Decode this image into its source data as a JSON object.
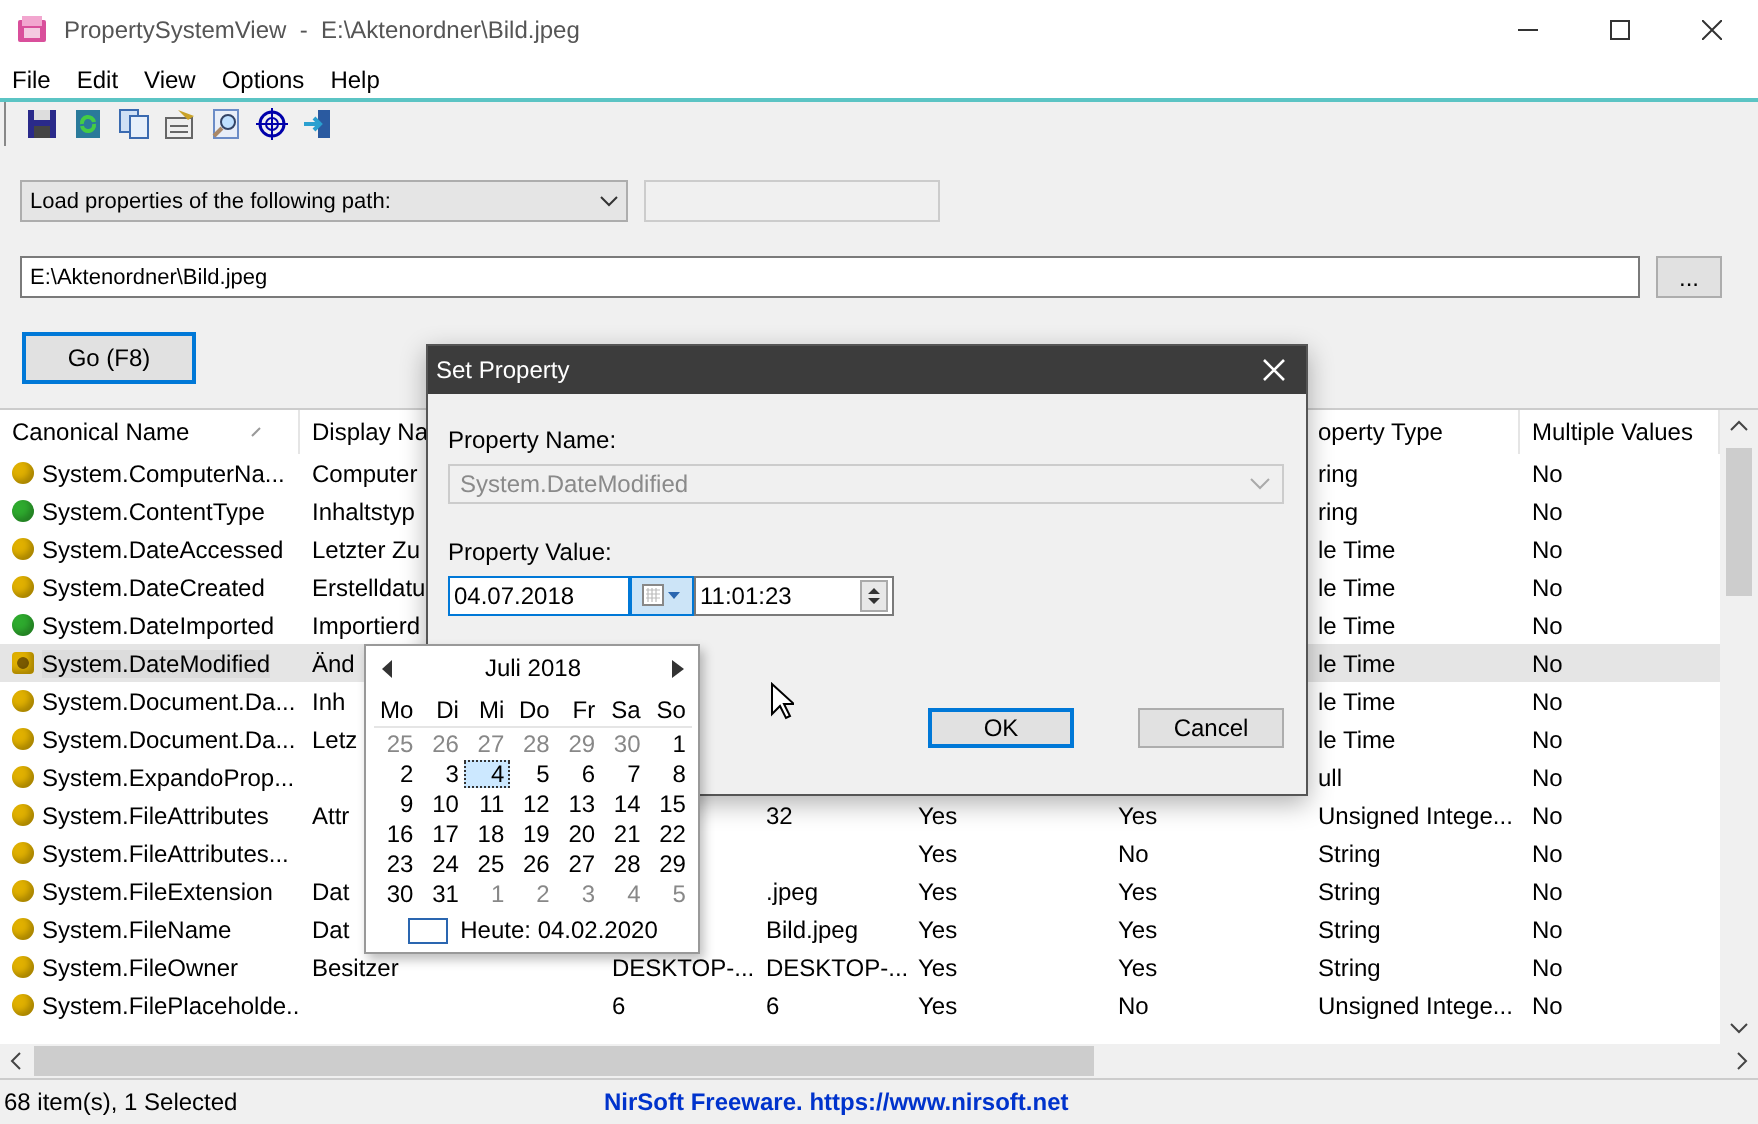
{
  "window": {
    "title": "PropertySystemView  -  E:\\Aktenordner\\Bild.jpeg"
  },
  "menu": [
    "File",
    "Edit",
    "View",
    "Options",
    "Help"
  ],
  "load_mode": {
    "value": "Load properties of the following path:"
  },
  "path_field": {
    "value": "E:\\Aktenordner\\Bild.jpeg"
  },
  "browse_button": "...",
  "go_button": {
    "label": "Go (F8)",
    "focused": true
  },
  "table": {
    "columns": [
      {
        "label": "Canonical Name",
        "sorted": true
      },
      {
        "label": "Display Na"
      },
      {},
      {},
      {},
      {},
      {
        "label": "operty Type"
      },
      {
        "label": "Multiple Values"
      }
    ],
    "rows": [
      {
        "canonical_name": "System.ComputerNa...",
        "display_name": "Computer",
        "property_type": "ring",
        "multiple_values": "No",
        "color": "#e0b000",
        "selected": false
      },
      {
        "canonical_name": "System.ContentType",
        "display_name": "Inhaltstyp",
        "property_type": "ring",
        "multiple_values": "No",
        "color": "#2eaa2e",
        "selected": false
      },
      {
        "canonical_name": "System.DateAccessed",
        "display_name": "Letzter Zu",
        "property_type": "le Time",
        "multiple_values": "No",
        "color": "#e0b000",
        "selected": false
      },
      {
        "canonical_name": "System.DateCreated",
        "display_name": "Erstelldatu",
        "property_type": "le Time",
        "multiple_values": "No",
        "color": "#e0b000",
        "selected": false
      },
      {
        "canonical_name": "System.DateImported",
        "display_name": "Importierd",
        "property_type": "le Time",
        "multiple_values": "No",
        "color": "#2eaa2e",
        "selected": false
      },
      {
        "canonical_name": "System.DateModified",
        "display_name": "Änd",
        "property_type": "le Time",
        "multiple_values": "No",
        "color": "#e0b000",
        "selected": true
      },
      {
        "canonical_name": "System.Document.Da...",
        "display_name": "Inh",
        "property_type": "le Time",
        "multiple_values": "No",
        "color": "#e0b000",
        "selected": false
      },
      {
        "canonical_name": "System.Document.Da...",
        "display_name": "Letz",
        "property_type": "le Time",
        "multiple_values": "No",
        "color": "#e0b000",
        "selected": false
      },
      {
        "canonical_name": "System.ExpandoProp...",
        "property_type": "ull",
        "multiple_values": "No",
        "color": "#e0b000",
        "selected": false
      },
      {
        "canonical_name": "System.FileAttributes",
        "display_name": "Attr",
        "column_4": "32",
        "column_5": "Yes",
        "column_6": "Yes",
        "property_type": "Unsigned Intege...",
        "multiple_values": "No",
        "color": "#e0b000",
        "selected": false
      },
      {
        "canonical_name": "System.FileAttributes...",
        "column_5": "Yes",
        "column_6": "No",
        "property_type": "String",
        "multiple_values": "No",
        "color": "#e0b000",
        "selected": false
      },
      {
        "canonical_name": "System.FileExtension",
        "display_name": "Dat",
        "column_4": ".jpeg",
        "column_5": "Yes",
        "column_6": "Yes",
        "property_type": "String",
        "multiple_values": "No",
        "color": "#e0b000",
        "selected": false
      },
      {
        "canonical_name": "System.FileName",
        "display_name": "Dat",
        "column_4": "Bild.jpeg",
        "column_5": "Yes",
        "column_6": "Yes",
        "property_type": "String",
        "multiple_values": "No",
        "color": "#e0b000",
        "selected": false
      },
      {
        "canonical_name": "System.FileOwner",
        "display_name": "Besitzer",
        "column_3": "DESKTOP-...",
        "column_4": "DESKTOP-...",
        "column_5": "Yes",
        "column_6": "Yes",
        "property_type": "String",
        "multiple_values": "No",
        "color": "#e0b000",
        "selected": false
      },
      {
        "canonical_name": "System.FilePlaceholde...",
        "column_3": "6",
        "column_4": "6",
        "column_5": "Yes",
        "column_6": "No",
        "property_type": "Unsigned Intege...",
        "multiple_values": "No",
        "color": "#e0b000",
        "selected": false
      }
    ]
  },
  "status_bar": {
    "count": "68 item(s), 1 Selected",
    "link": "NirSoft Freeware. https://www.nirsoft.net"
  },
  "dialog": {
    "title": "Set Property",
    "name_label": "Property Name:",
    "name_value": "System.DateModified",
    "name_disabled": true,
    "value_label": "Property Value:",
    "date": "04.07.2018",
    "time": "11:01:23",
    "calendar_open": true,
    "buttons": [
      {
        "label": "OK",
        "default": true
      },
      {
        "label": "Cancel",
        "default": false
      }
    ]
  },
  "calendar": {
    "month": "Juli 2018",
    "weekdays": [
      "Mo",
      "Di",
      "Mi",
      "Do",
      "Fr",
      "Sa",
      "So"
    ],
    "weeks": [
      [
        {
          "day": "25",
          "other_month": true,
          "selected": false
        },
        {
          "day": "26",
          "other_month": true,
          "selected": false
        },
        {
          "day": "27",
          "other_month": true,
          "selected": false
        },
        {
          "day": "28",
          "other_month": true,
          "selected": false
        },
        {
          "day": "29",
          "other_month": true,
          "selected": false
        },
        {
          "day": "30",
          "other_month": true,
          "selected": false
        },
        {
          "day": "1",
          "other_month": false,
          "selected": false
        }
      ],
      [
        {
          "day": "2",
          "other_month": false,
          "selected": false
        },
        {
          "day": "3",
          "other_month": false,
          "selected": false
        },
        {
          "day": "4",
          "other_month": false,
          "selected": true
        },
        {
          "day": "5",
          "other_month": false,
          "selected": false
        },
        {
          "day": "6",
          "other_month": false,
          "selected": false
        },
        {
          "day": "7",
          "other_month": false,
          "selected": false
        },
        {
          "day": "8",
          "other_month": false,
          "selected": false
        }
      ],
      [
        {
          "day": "9",
          "other_month": false,
          "selected": false
        },
        {
          "day": "10",
          "other_month": false,
          "selected": false
        },
        {
          "day": "11",
          "other_month": false,
          "selected": false
        },
        {
          "day": "12",
          "other_month": false,
          "selected": false
        },
        {
          "day": "13",
          "other_month": false,
          "selected": false
        },
        {
          "day": "14",
          "other_month": false,
          "selected": false
        },
        {
          "day": "15",
          "other_month": false,
          "selected": false
        }
      ],
      [
        {
          "day": "16",
          "other_month": false,
          "selected": false
        },
        {
          "day": "17",
          "other_month": false,
          "selected": false
        },
        {
          "day": "18",
          "other_month": false,
          "selected": false
        },
        {
          "day": "19",
          "other_month": false,
          "selected": false
        },
        {
          "day": "20",
          "other_month": false,
          "selected": false
        },
        {
          "day": "21",
          "other_month": false,
          "selected": false
        },
        {
          "day": "22",
          "other_month": false,
          "selected": false
        }
      ],
      [
        {
          "day": "23",
          "other_month": false,
          "selected": false
        },
        {
          "day": "24",
          "other_month": false,
          "selected": false
        },
        {
          "day": "25",
          "other_month": false,
          "selected": false
        },
        {
          "day": "26",
          "other_month": false,
          "selected": false
        },
        {
          "day": "27",
          "other_month": false,
          "selected": false
        },
        {
          "day": "28",
          "other_month": false,
          "selected": false
        },
        {
          "day": "29",
          "other_month": false,
          "selected": false
        }
      ],
      [
        {
          "day": "30",
          "other_month": false,
          "selected": false
        },
        {
          "day": "31",
          "other_month": false,
          "selected": false
        },
        {
          "day": "1",
          "other_month": true,
          "selected": false
        },
        {
          "day": "2",
          "other_month": true,
          "selected": false
        },
        {
          "day": "3",
          "other_month": true,
          "selected": false
        },
        {
          "day": "4",
          "other_month": true,
          "selected": false
        },
        {
          "day": "5",
          "other_month": true,
          "selected": false
        }
      ]
    ],
    "today": "Heute: 04.02.2020"
  }
}
